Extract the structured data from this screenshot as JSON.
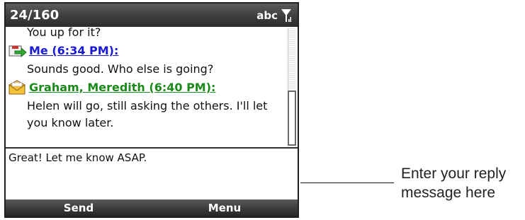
{
  "status_bar": {
    "counter": "24/160",
    "input_mode": "abc",
    "signal_icon": "signal-antenna-icon"
  },
  "conversation": {
    "continuation_line": "You up for it?",
    "messages": [
      {
        "sender": "Me (6:34 PM):",
        "icon": "sent-message-icon",
        "color": "#1a1ad6",
        "lines": [
          "Sounds good. Who else is going?"
        ]
      },
      {
        "sender": "Graham, Meredith (6:40 PM):",
        "icon": "received-envelope-icon",
        "color": "#1a8a1a",
        "lines": [
          "Helen will go, still asking the others. I'll let",
          "you know later."
        ]
      }
    ]
  },
  "reply": {
    "value": "Great! Let me know ASAP."
  },
  "softkeys": {
    "left": "Send",
    "right": "Menu"
  },
  "callout": {
    "line1": "Enter your reply",
    "line2": "message here"
  }
}
